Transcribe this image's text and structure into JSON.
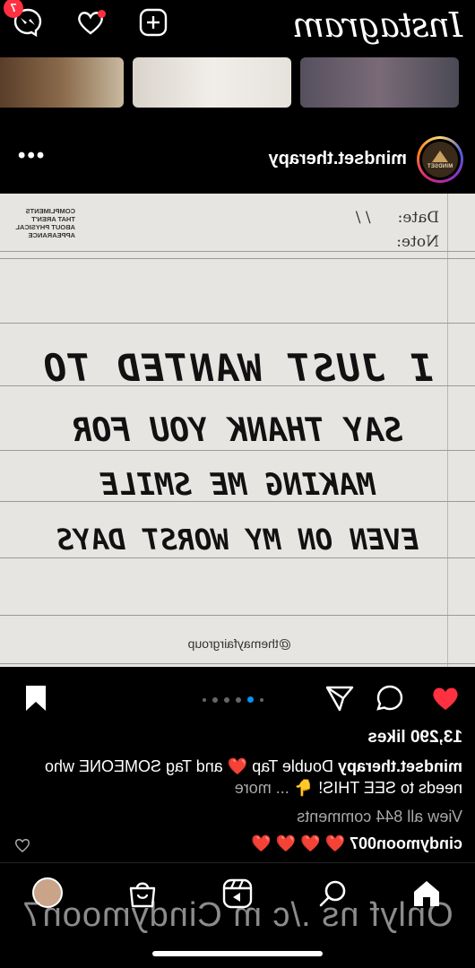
{
  "app": {
    "logo": "Instagram",
    "notifications_badge": "7",
    "accent": "#ff3040"
  },
  "post": {
    "username": "mindset.therapy",
    "avatar_label": "MINDSET",
    "more_label": "•••",
    "image": {
      "date_label": "Date:",
      "date_value_sep": "/        /",
      "note_label": "Note:",
      "compliments_lines": [
        "COMPLIMENTS",
        "THAT AREN'T",
        "ABOUT PHYSICAL",
        "APPEARANCE"
      ],
      "handwritten": [
        "I JUST WANTED TO",
        "SAY THANK YOU FOR",
        "MAKING ME SMILE",
        "EVEN ON MY WORST DAYS"
      ],
      "credit": "@themayfairgroup"
    },
    "likes": "13,290 likes",
    "caption": {
      "username": "mindset.therapy",
      "text_before_heart": "Double Tap",
      "text_after_heart": "and Tag SOMEONE who needs to SEE THIS!",
      "pointing_emoji": "👇",
      "more": "... more"
    },
    "view_comments": "View all 844 comments",
    "top_comment": {
      "username": "cindymoon007",
      "hearts": "❤️ ❤️ ❤️ ❤️"
    },
    "carousel": {
      "count": 6,
      "active_index": 1
    },
    "liked": true,
    "like_color": "#ff3040",
    "carousel_active_color": "#0095f6"
  },
  "overlay": {
    "watermark": "Onlyf ns ./c m Cindymoon7"
  },
  "nav": {
    "items": [
      "home-icon",
      "search-icon",
      "reels-icon",
      "shop-icon",
      "profile-avatar"
    ]
  }
}
